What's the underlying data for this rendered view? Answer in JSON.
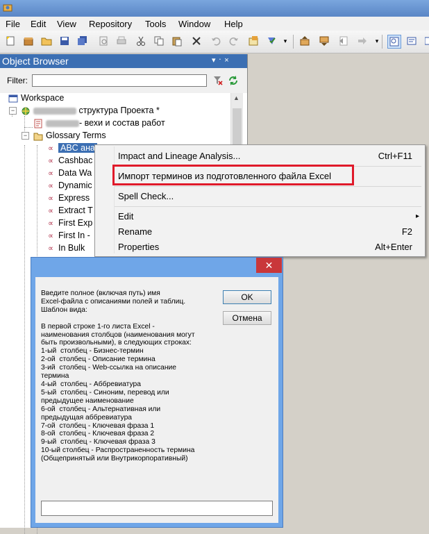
{
  "menu": [
    "File",
    "Edit",
    "View",
    "Repository",
    "Tools",
    "Window",
    "Help"
  ],
  "toolbar_icons": [
    "new-icon",
    "open-package-icon",
    "open-folder-icon",
    "save-icon",
    "save-all-icon",
    "print-preview-icon",
    "print-icon",
    "cut-icon",
    "copy-icon",
    "paste-icon",
    "delete-icon",
    "undo-icon",
    "redo-icon",
    "properties-icon",
    "check-icon",
    "dropdown-icon",
    "folder-up-icon",
    "folder-down-icon",
    "arrow-left-icon",
    "arrow-right-icon",
    "dropdown-icon",
    "browser-icon",
    "output-icon",
    "list-icon"
  ],
  "browser": {
    "title": "Object Browser",
    "pin": "▾ ᛫ ×",
    "filter_label": "Filter:",
    "filter_value": "",
    "tree": {
      "workspace": "Workspace",
      "model": "структура Проекта *",
      "diagram": "- вехи и состав работ",
      "folder": "Glossary Terms",
      "terms": [
        "ABC ана",
        "Cashbac",
        "Data Wa",
        "Dynamic",
        "Express",
        "Extract T",
        "First Exp",
        "First In -",
        "In Bulk"
      ]
    }
  },
  "context_menu": {
    "items": [
      {
        "label": "Impact and Lineage Analysis...",
        "shortcut": "Ctrl+F11"
      },
      {
        "label": "Импорт терминов  из подготовленного файла Excel",
        "shortcut": ""
      },
      {
        "label": "Spell Check...",
        "shortcut": ""
      },
      {
        "label": "Edit",
        "shortcut": "▸"
      },
      {
        "label": "Rename",
        "shortcut": "F2"
      },
      {
        "label": "Properties",
        "shortcut": "Alt+Enter"
      }
    ],
    "highlight_color": "#e01a2a"
  },
  "dialog": {
    "close": "✕",
    "prompt": "Введите полное (включая путь) имя\nExcel-файла с описаниями полей и таблиц.\nШаблон вида:\n\nВ первой строке 1-го листа Excel -\nнаименования столбцов (наименования могут\nбыть произвольными), в следующих строках:\n1-ый  столбец - Бизнес-термин\n2-ой  столбец - Описание термина\n3-ий  столбец - Web-ссылка на описание\nтермина\n4-ый  столбец - Аббревиатура\n5-ый  столбец - Синоним, перевод или\nпредыдущее наименование\n6-ой  столбец - Альтернативная или\nпредыдущая аббревиатура\n7-ой  столбец - Ключевая фраза 1\n8-ой  столбец - Ключевая фраза 2\n9-ый  столбец - Ключевая фраза 3\n10-ый столбец - Распространенность термина\n(Общепринятый или Внутрикорпоративный)",
    "ok_label": "OK",
    "cancel_label": "Отмена",
    "path_value": ""
  },
  "colors": {
    "panel_header": "#3c6fb3",
    "dialog_frame": "#6fa6e8",
    "close_red": "#c9373a"
  }
}
